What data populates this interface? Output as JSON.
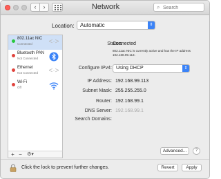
{
  "window": {
    "title": "Network",
    "search": {
      "placeholder": "Search"
    }
  },
  "location": {
    "label": "Location:",
    "value": "Automatic"
  },
  "services": [
    {
      "name": "802.11ac NIC",
      "status": "Connected",
      "status_color": "#28c840",
      "icon": "ethernet-arrows-icon",
      "selected": true
    },
    {
      "name": "Bluetooth PAN",
      "status": "Not Connected",
      "status_color": "#e0443e",
      "icon": "bluetooth-icon",
      "selected": false
    },
    {
      "name": "Ethernet",
      "status": "Not Connected",
      "status_color": "#e0443e",
      "icon": "ethernet-arrows-icon",
      "selected": false
    },
    {
      "name": "Wi-Fi",
      "status": "Off",
      "status_color": "#e0443e",
      "icon": "wifi-icon",
      "selected": false
    }
  ],
  "sidebar_controls": {
    "add": "+",
    "remove": "−",
    "gear": "⚙▾"
  },
  "detail": {
    "status_label": "Status:",
    "status_value": "Connected",
    "status_note": "802.11ac NIC is currently active and has the IP address 192.168.99.113.",
    "configure_label": "Configure IPv4:",
    "configure_value": "Using DHCP",
    "ip_label": "IP Address:",
    "ip_value": "192.168.99.113",
    "subnet_label": "Subnet Mask:",
    "subnet_value": "255.255.255.0",
    "router_label": "Router:",
    "router_value": "192.168.99.1",
    "dns_label": "DNS Server:",
    "dns_value": "192.168.99.1",
    "search_domains_label": "Search Domains:"
  },
  "buttons": {
    "advanced": "Advanced...",
    "help": "?",
    "revert": "Revert",
    "apply": "Apply"
  },
  "lock_text": "Click the lock to prevent further changes."
}
